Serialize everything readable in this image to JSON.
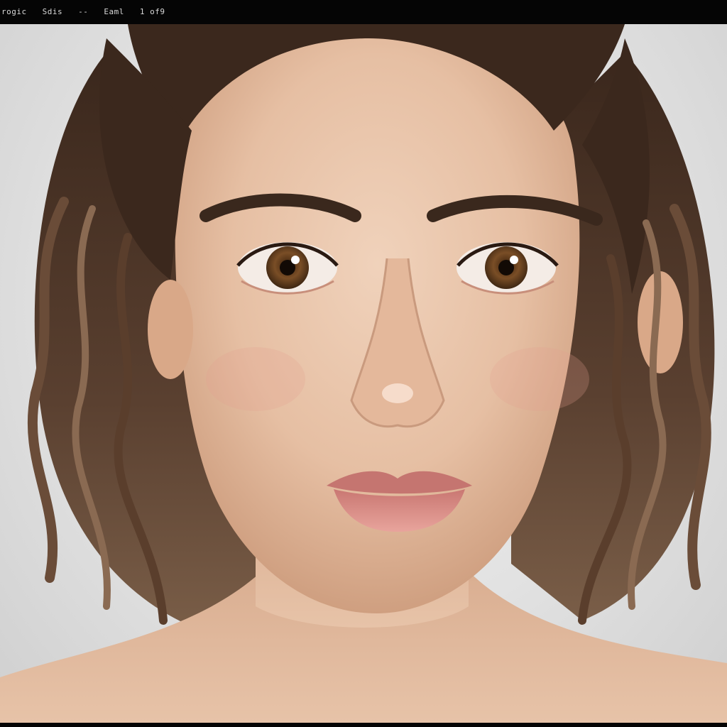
{
  "titlebar": {
    "segments": [
      "rogic",
      "Sdis",
      "--",
      "Eaml",
      "1 of9"
    ]
  },
  "image": {
    "subject": "portrait"
  },
  "colors": {
    "background": "#e6e6e6",
    "skin": "#e8c2a6",
    "hair": "#4a3426",
    "iris": "#6b4523",
    "lips": "#d98a86",
    "bar": "#050505"
  }
}
